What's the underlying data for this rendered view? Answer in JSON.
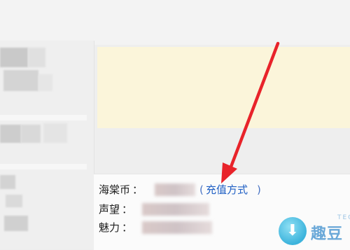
{
  "account_info": {
    "rows": [
      {
        "label": "海棠币",
        "colon": "：",
        "value_masked": true
      },
      {
        "label": "声望",
        "colon": "：",
        "value_masked": true
      },
      {
        "label": "魅力",
        "colon": "：",
        "value_masked": true
      }
    ],
    "recharge": {
      "open_paren": "(",
      "link_text": "充值方式",
      "close_paren": ")"
    }
  },
  "annotation": {
    "arrow_color": "#e8232a"
  },
  "watermark": {
    "text": "趣豆",
    "small_text": "TECH"
  },
  "colors": {
    "notice_background": "#fbf5da",
    "link": "#1f5fc4",
    "page_background": "#eeeeee"
  }
}
